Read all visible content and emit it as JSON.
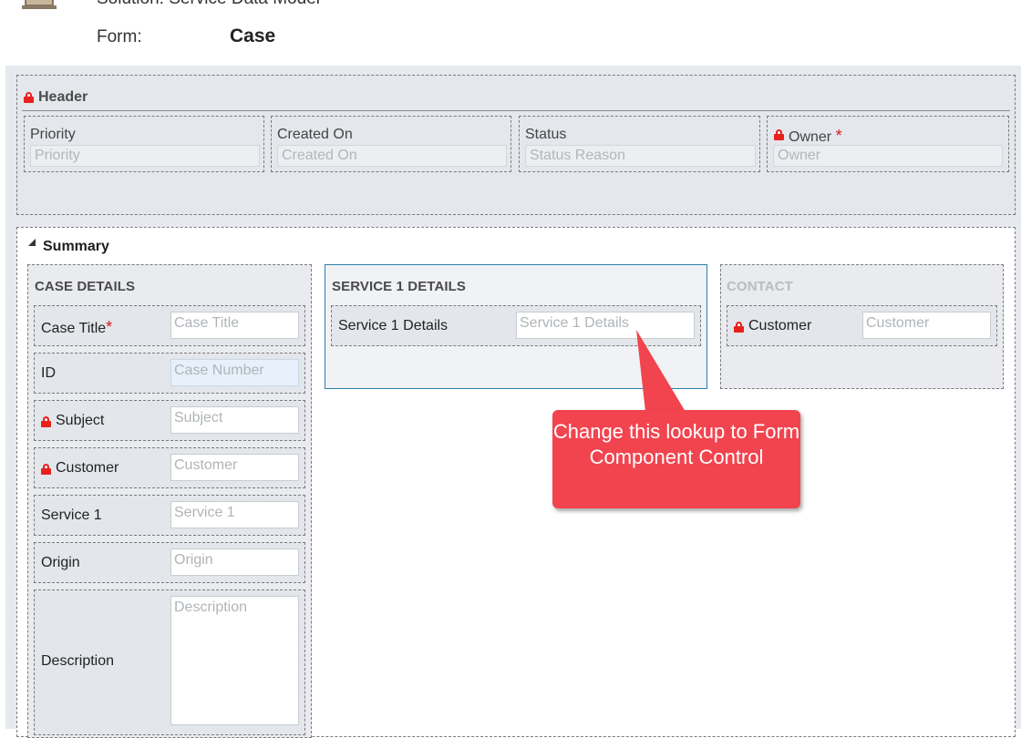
{
  "top": {
    "solution_label": "Solution: Service Data Model",
    "form_label": "Form:",
    "form_name": "Case"
  },
  "header": {
    "title": "Header",
    "fields": [
      {
        "label": "Priority",
        "placeholder": "Priority",
        "locked": false,
        "required": false
      },
      {
        "label": "Created On",
        "placeholder": "Created On",
        "locked": false,
        "required": false
      },
      {
        "label": "Status",
        "placeholder": "Status Reason",
        "locked": false,
        "required": false
      },
      {
        "label": "Owner",
        "placeholder": "Owner",
        "locked": true,
        "required": true
      }
    ]
  },
  "summary": {
    "title": "Summary",
    "case_details": {
      "title": "CASE DETAILS",
      "fields": [
        {
          "label": "Case Title",
          "placeholder": "Case Title",
          "required": true
        },
        {
          "label": "ID",
          "placeholder": "Case Number"
        },
        {
          "label": "Subject",
          "placeholder": "Subject",
          "locked": true
        },
        {
          "label": "Customer",
          "placeholder": "Customer",
          "locked": true
        },
        {
          "label": "Service 1",
          "placeholder": "Service 1"
        },
        {
          "label": "Origin",
          "placeholder": "Origin"
        },
        {
          "label": "Description",
          "placeholder": "Description"
        }
      ]
    },
    "service_details": {
      "title": "SERVICE 1 DETAILS",
      "fields": [
        {
          "label": "Service 1 Details",
          "placeholder": "Service 1 Details"
        }
      ]
    },
    "contact": {
      "title": "CONTACT",
      "fields": [
        {
          "label": "Customer",
          "placeholder": "Customer",
          "locked": true
        }
      ]
    }
  },
  "callout": {
    "text": "Change this lookup to Form Component Control"
  },
  "colors": {
    "callout": "#f1444f",
    "lock": "#e8211d",
    "required": "#d11b1b",
    "canvas": "#e6e9ee"
  },
  "icons": {
    "solution": "solution-icon",
    "lock": "lock-icon",
    "collapse": "collapse-triangle-icon"
  }
}
